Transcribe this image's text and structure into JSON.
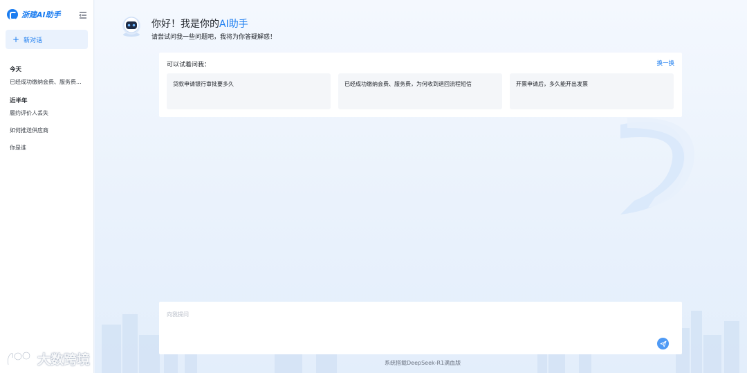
{
  "brand": {
    "name": "浙建AI助手"
  },
  "sidebar": {
    "new_chat_label": "新对话",
    "groups": [
      {
        "title": "今天",
        "items": [
          "已经成功缴纳会费、服务费..."
        ]
      },
      {
        "title": "近半年",
        "items": [
          "履约评价人丢失",
          "如何推送供应商",
          "你是谁"
        ]
      }
    ]
  },
  "header": {
    "greeting_prefix": "你好！我是你的",
    "greeting_accent": "AI助手",
    "subtitle": "请尝试问我一些问题吧，我将为你答疑解惑！"
  },
  "suggestions": {
    "title": "可以试着问我：",
    "refresh_label": "换一换",
    "items": [
      "贷款申请银行审批要多久",
      "已经成功缴纳会费、服务费，为何收到退回流程短信",
      "开票申请后，多久能开出发票"
    ]
  },
  "input": {
    "placeholder": "向我提问"
  },
  "footer": {
    "note": "系统搭载DeepSeek-R1满血版"
  },
  "watermark": {
    "text": "大数跨境"
  },
  "colors": {
    "accent": "#1a7cf0",
    "send": "#4f9af5",
    "new_chat_bg": "#eaf2fd"
  }
}
